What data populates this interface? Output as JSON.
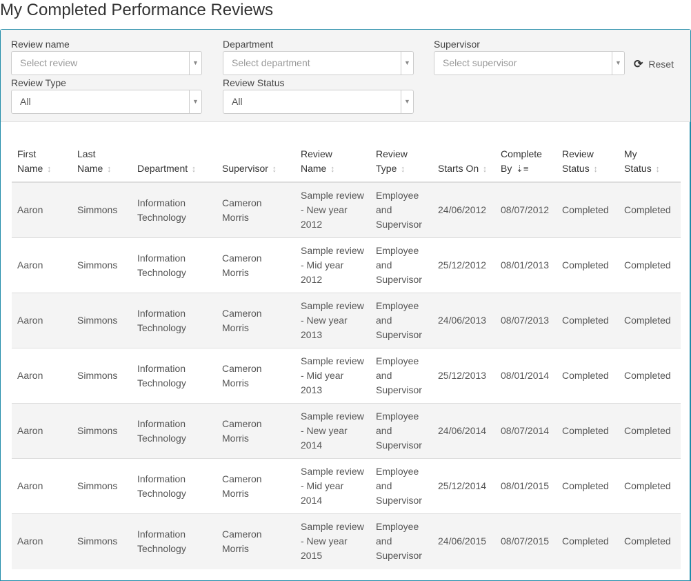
{
  "title": "My Completed Performance Reviews",
  "filters": {
    "review_name": {
      "label": "Review name",
      "placeholder": "Select review"
    },
    "department": {
      "label": "Department",
      "placeholder": "Select department"
    },
    "supervisor": {
      "label": "Supervisor",
      "placeholder": "Select supervisor"
    },
    "review_type": {
      "label": "Review Type",
      "value": "All"
    },
    "review_status": {
      "label": "Review Status",
      "value": "All"
    },
    "reset": "Reset"
  },
  "columns": [
    [
      "First",
      "Name"
    ],
    [
      "Last",
      "Name"
    ],
    [
      "",
      "Department"
    ],
    [
      "",
      "Supervisor"
    ],
    [
      "Review",
      "Name"
    ],
    [
      "Review",
      "Type"
    ],
    [
      "",
      "Starts On"
    ],
    [
      "Complete",
      "By"
    ],
    [
      "Review",
      "Status"
    ],
    [
      "My",
      "Status"
    ]
  ],
  "rows": [
    [
      "Aaron",
      "Simmons",
      "Information Technology",
      "Cameron Morris",
      "Sample review - New year 2012",
      "Employee and Supervisor",
      "24/06/2012",
      "08/07/2012",
      "Completed",
      "Completed"
    ],
    [
      "Aaron",
      "Simmons",
      "Information Technology",
      "Cameron Morris",
      "Sample review - Mid year 2012",
      "Employee and Supervisor",
      "25/12/2012",
      "08/01/2013",
      "Completed",
      "Completed"
    ],
    [
      "Aaron",
      "Simmons",
      "Information Technology",
      "Cameron Morris",
      "Sample review - New year 2013",
      "Employee and Supervisor",
      "24/06/2013",
      "08/07/2013",
      "Completed",
      "Completed"
    ],
    [
      "Aaron",
      "Simmons",
      "Information Technology",
      "Cameron Morris",
      "Sample review - Mid year 2013",
      "Employee and Supervisor",
      "25/12/2013",
      "08/01/2014",
      "Completed",
      "Completed"
    ],
    [
      "Aaron",
      "Simmons",
      "Information Technology",
      "Cameron Morris",
      "Sample review - New year 2014",
      "Employee and Supervisor",
      "24/06/2014",
      "08/07/2014",
      "Completed",
      "Completed"
    ],
    [
      "Aaron",
      "Simmons",
      "Information Technology",
      "Cameron Morris",
      "Sample review - Mid year 2014",
      "Employee and Supervisor",
      "25/12/2014",
      "08/01/2015",
      "Completed",
      "Completed"
    ],
    [
      "Aaron",
      "Simmons",
      "Information Technology",
      "Cameron Morris",
      "Sample review - New year 2015",
      "Employee and Supervisor",
      "24/06/2015",
      "08/07/2015",
      "Completed",
      "Completed"
    ]
  ]
}
